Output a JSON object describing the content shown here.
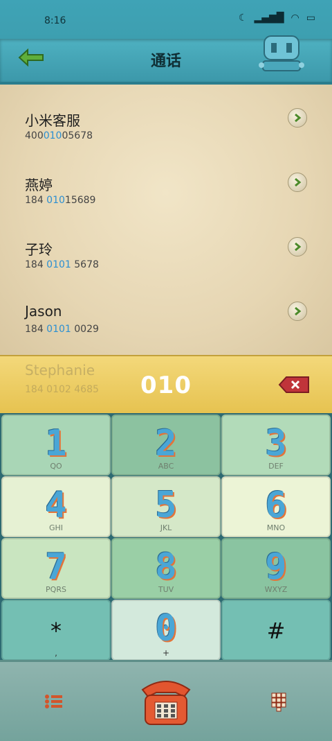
{
  "status_bar": {
    "time": "8:16"
  },
  "header": {
    "title": "通话"
  },
  "contacts": [
    {
      "name": "小米客服",
      "num_pre": "400",
      "num_hl": "010",
      "num_post": "05678"
    },
    {
      "name": "燕婷",
      "num_pre": "184 ",
      "num_hl": "010",
      "num_post": "15689"
    },
    {
      "name": "子玲",
      "num_pre": "184 ",
      "num_hl": "0101",
      "num_post": " 5678"
    },
    {
      "name": "Jason",
      "num_pre": "184 ",
      "num_hl": "0101",
      "num_post": " 0029"
    },
    {
      "name": "Stephanie",
      "num_pre": "184 ",
      "num_hl": "010",
      "num_post": "2 4685"
    }
  ],
  "display": {
    "digits": "010"
  },
  "keypad": {
    "keys": [
      {
        "digit": "1",
        "letters": "QO"
      },
      {
        "digit": "2",
        "letters": "ABC"
      },
      {
        "digit": "3",
        "letters": "DEF"
      },
      {
        "digit": "4",
        "letters": "GHI"
      },
      {
        "digit": "5",
        "letters": "JKL"
      },
      {
        "digit": "6",
        "letters": "MNO"
      },
      {
        "digit": "7",
        "letters": "PQRS"
      },
      {
        "digit": "8",
        "letters": "TUV"
      },
      {
        "digit": "9",
        "letters": "WXYZ"
      },
      {
        "digit": "*",
        "letters": ","
      },
      {
        "digit": "0",
        "letters": "+"
      },
      {
        "digit": "#",
        "letters": ""
      }
    ]
  },
  "colors": {
    "highlight": "#2b8fd2",
    "display_bg": "#e6c24f",
    "header_bg": "#3c98aa"
  }
}
